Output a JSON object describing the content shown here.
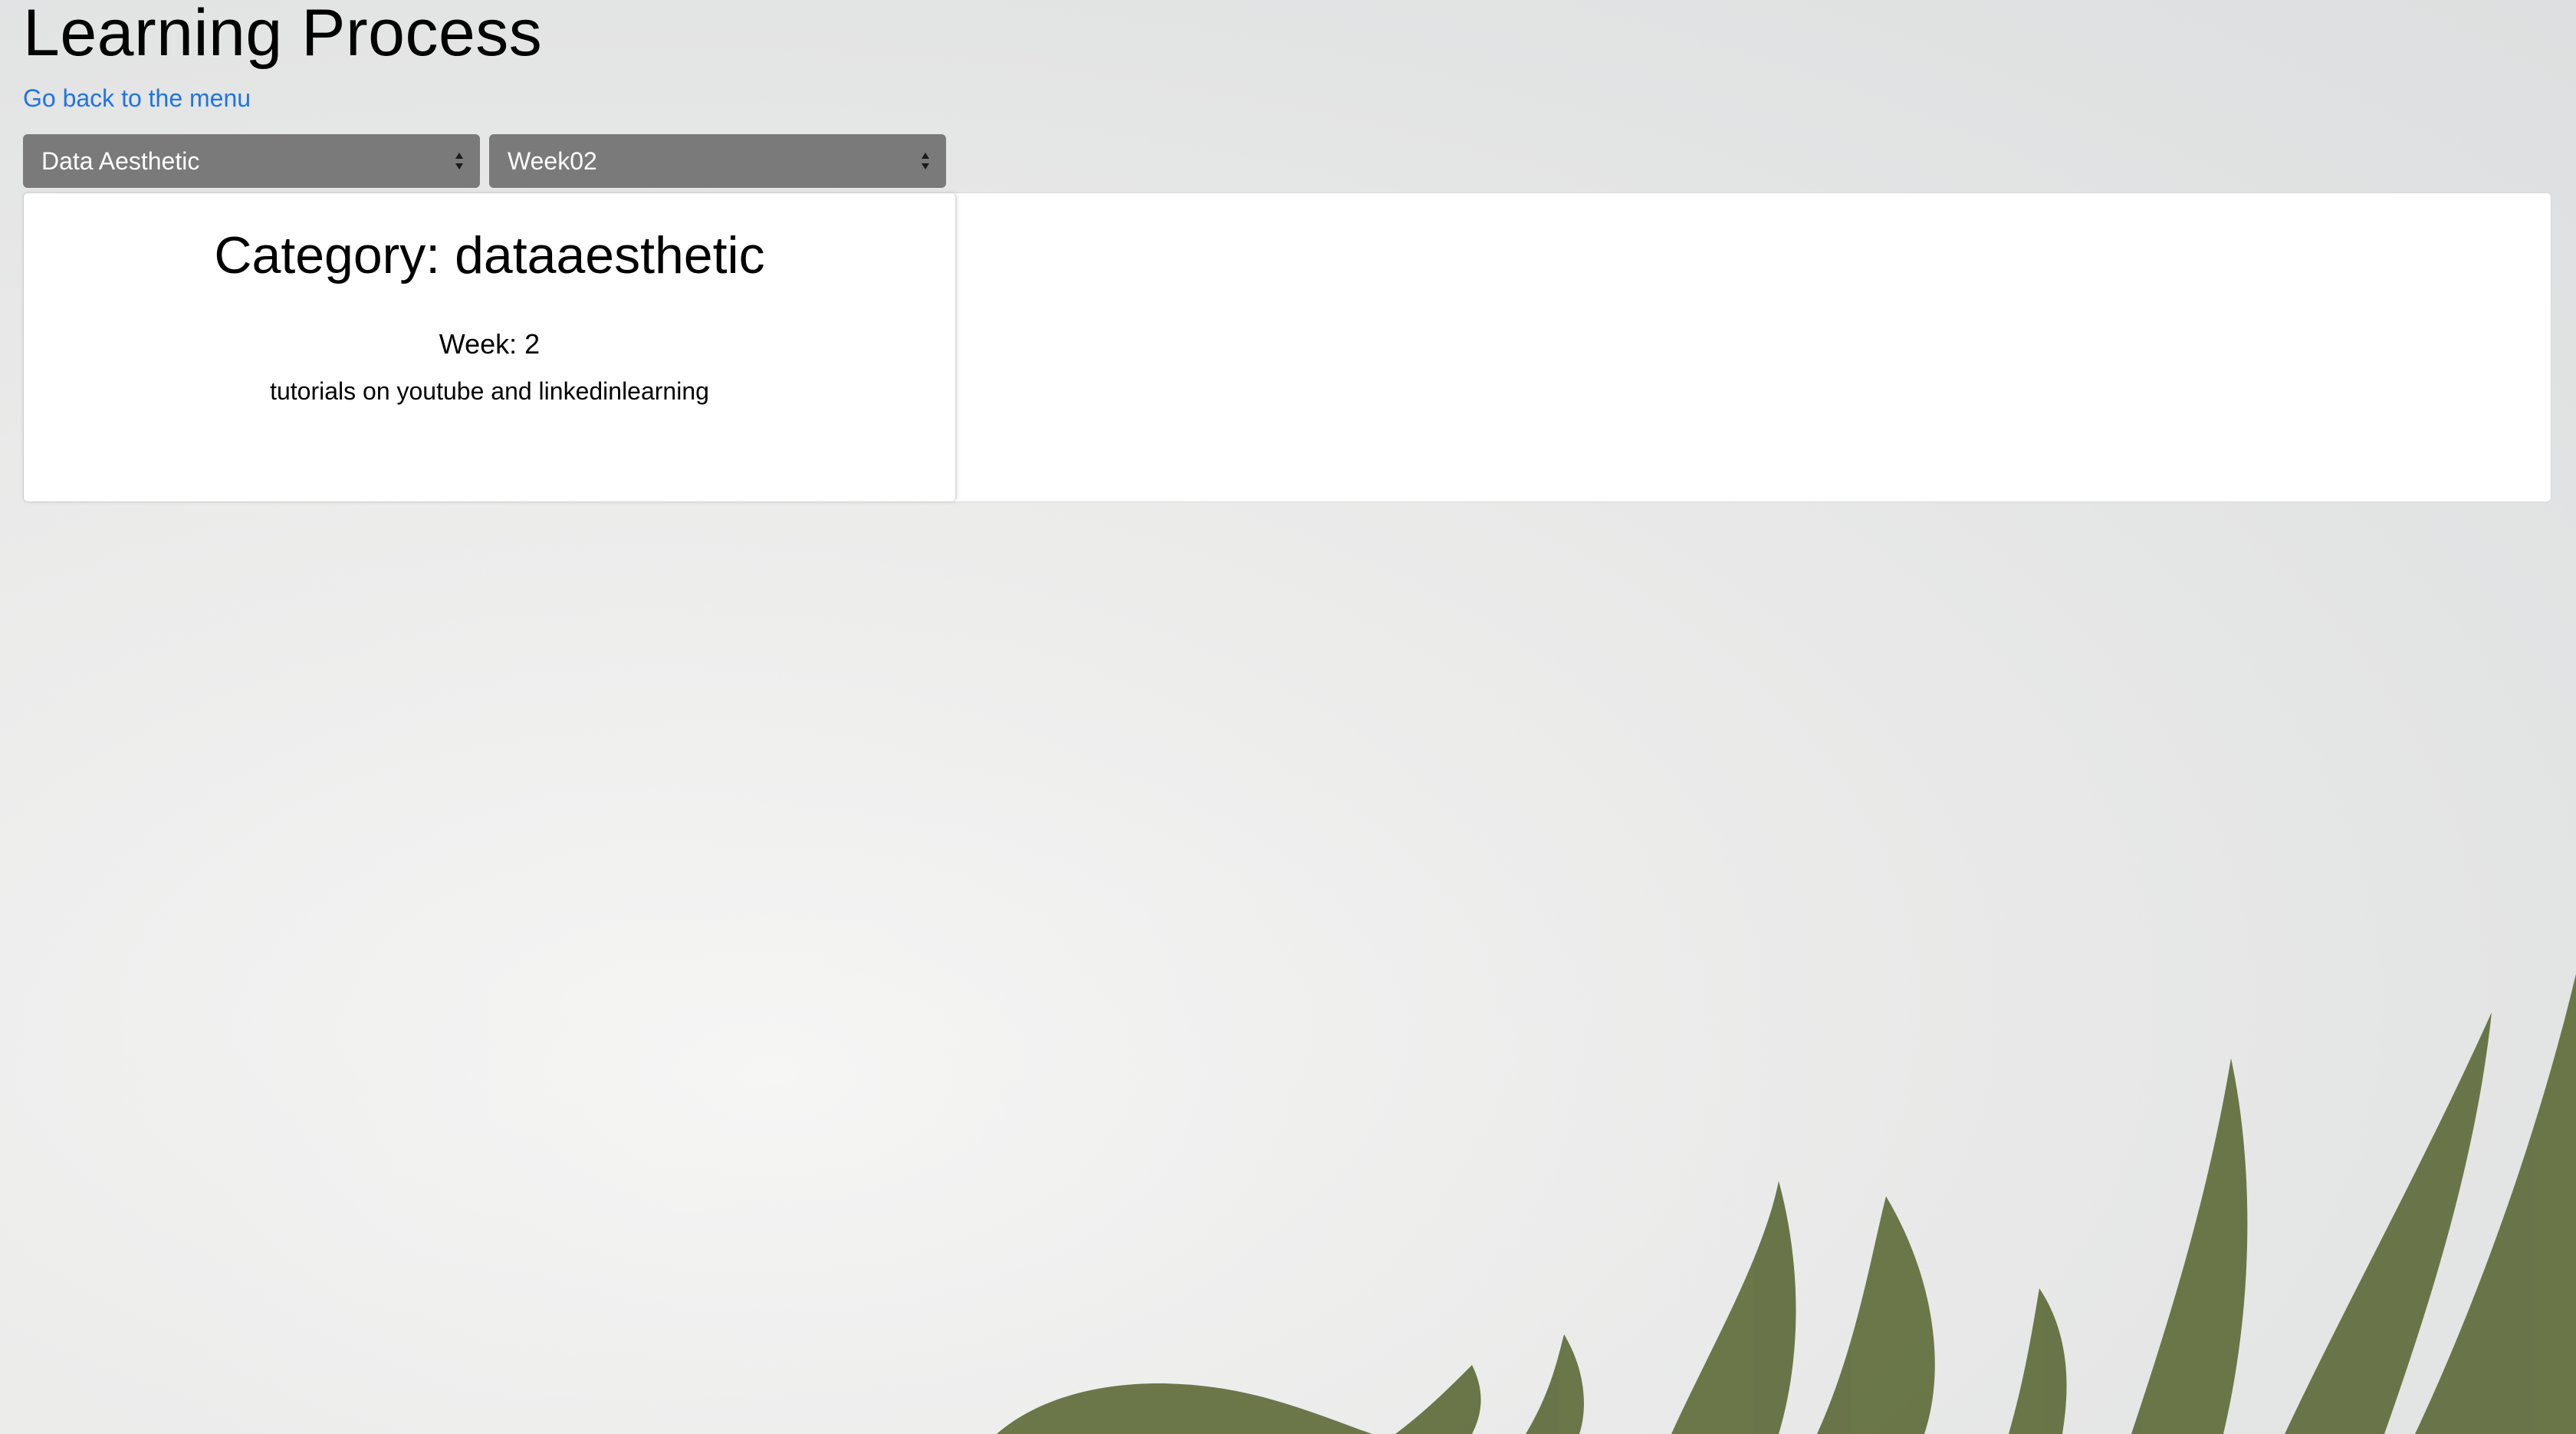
{
  "page": {
    "title": "Learning Process",
    "back_link": "Go back to the menu"
  },
  "filters": {
    "category_selected": "Data Aesthetic",
    "week_selected": "Week02"
  },
  "card": {
    "category_line": "Category: dataaesthetic",
    "week_line": "Week: 2",
    "description": "tutorials on youtube and linkedinlearning"
  },
  "colors": {
    "link": "#1f74e6",
    "select_bg": "#7a7a7a",
    "fern": "#5e6b3a"
  },
  "icons": {
    "select_arrow": "sort-arrows-icon"
  }
}
